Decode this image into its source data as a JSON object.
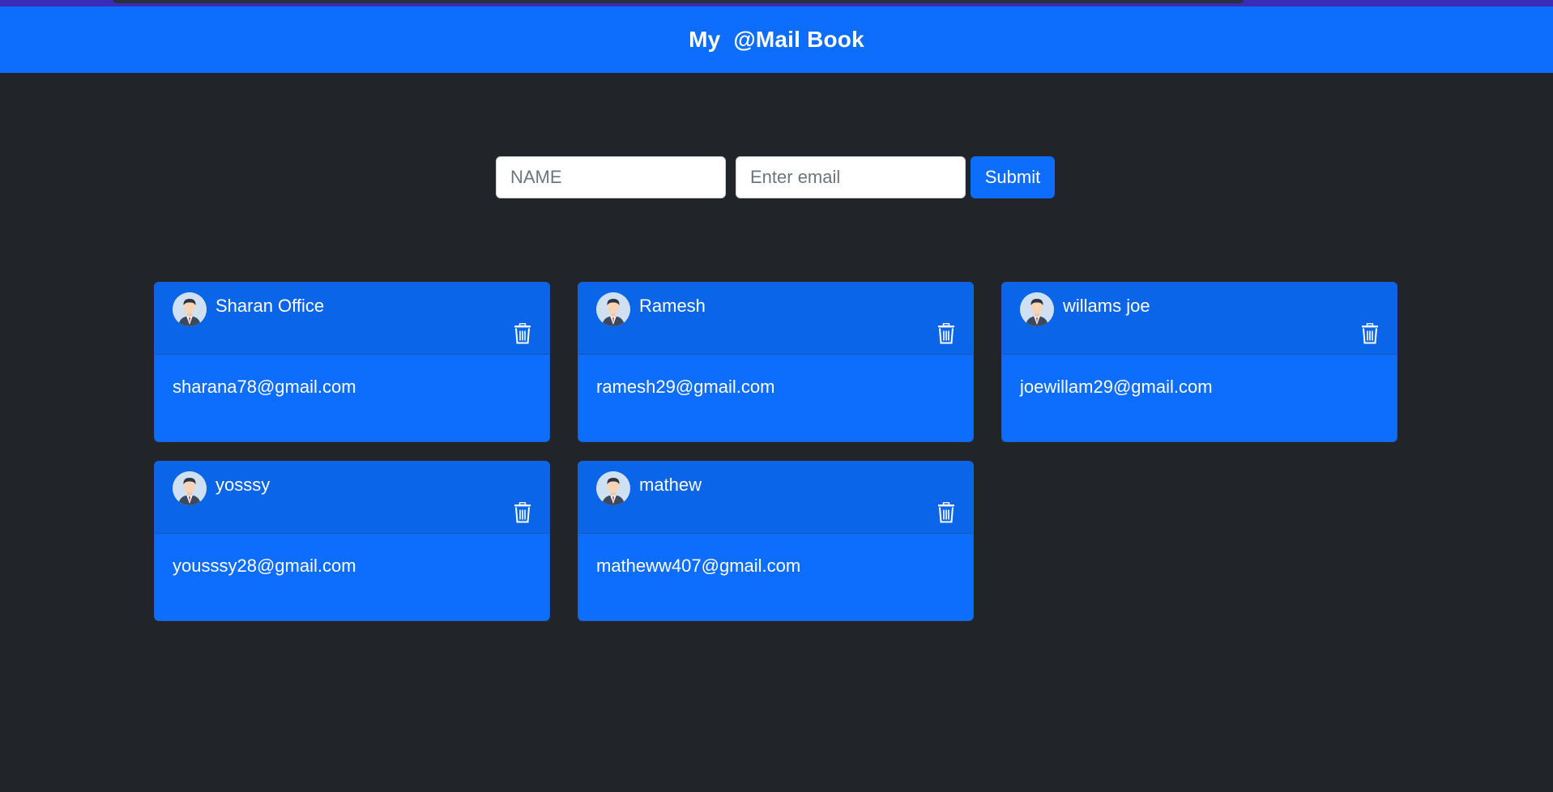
{
  "header": {
    "title": "My  @Mail Book"
  },
  "form": {
    "name_placeholder": "NAME",
    "email_placeholder": "Enter email",
    "submit_label": "Submit"
  },
  "contacts": [
    {
      "name": "Sharan Office",
      "email": "sharana78@gmail.com"
    },
    {
      "name": "Ramesh",
      "email": "ramesh29@gmail.com"
    },
    {
      "name": "willams joe",
      "email": "joewillam29@gmail.com"
    },
    {
      "name": "yosssy",
      "email": "yousssy28@gmail.com"
    },
    {
      "name": "mathew",
      "email": "matheww407@gmail.com"
    }
  ],
  "icons": {
    "avatar": "user-avatar-icon",
    "delete": "trash-icon"
  },
  "colors": {
    "primary": "#0d6efd",
    "background": "#212529"
  }
}
